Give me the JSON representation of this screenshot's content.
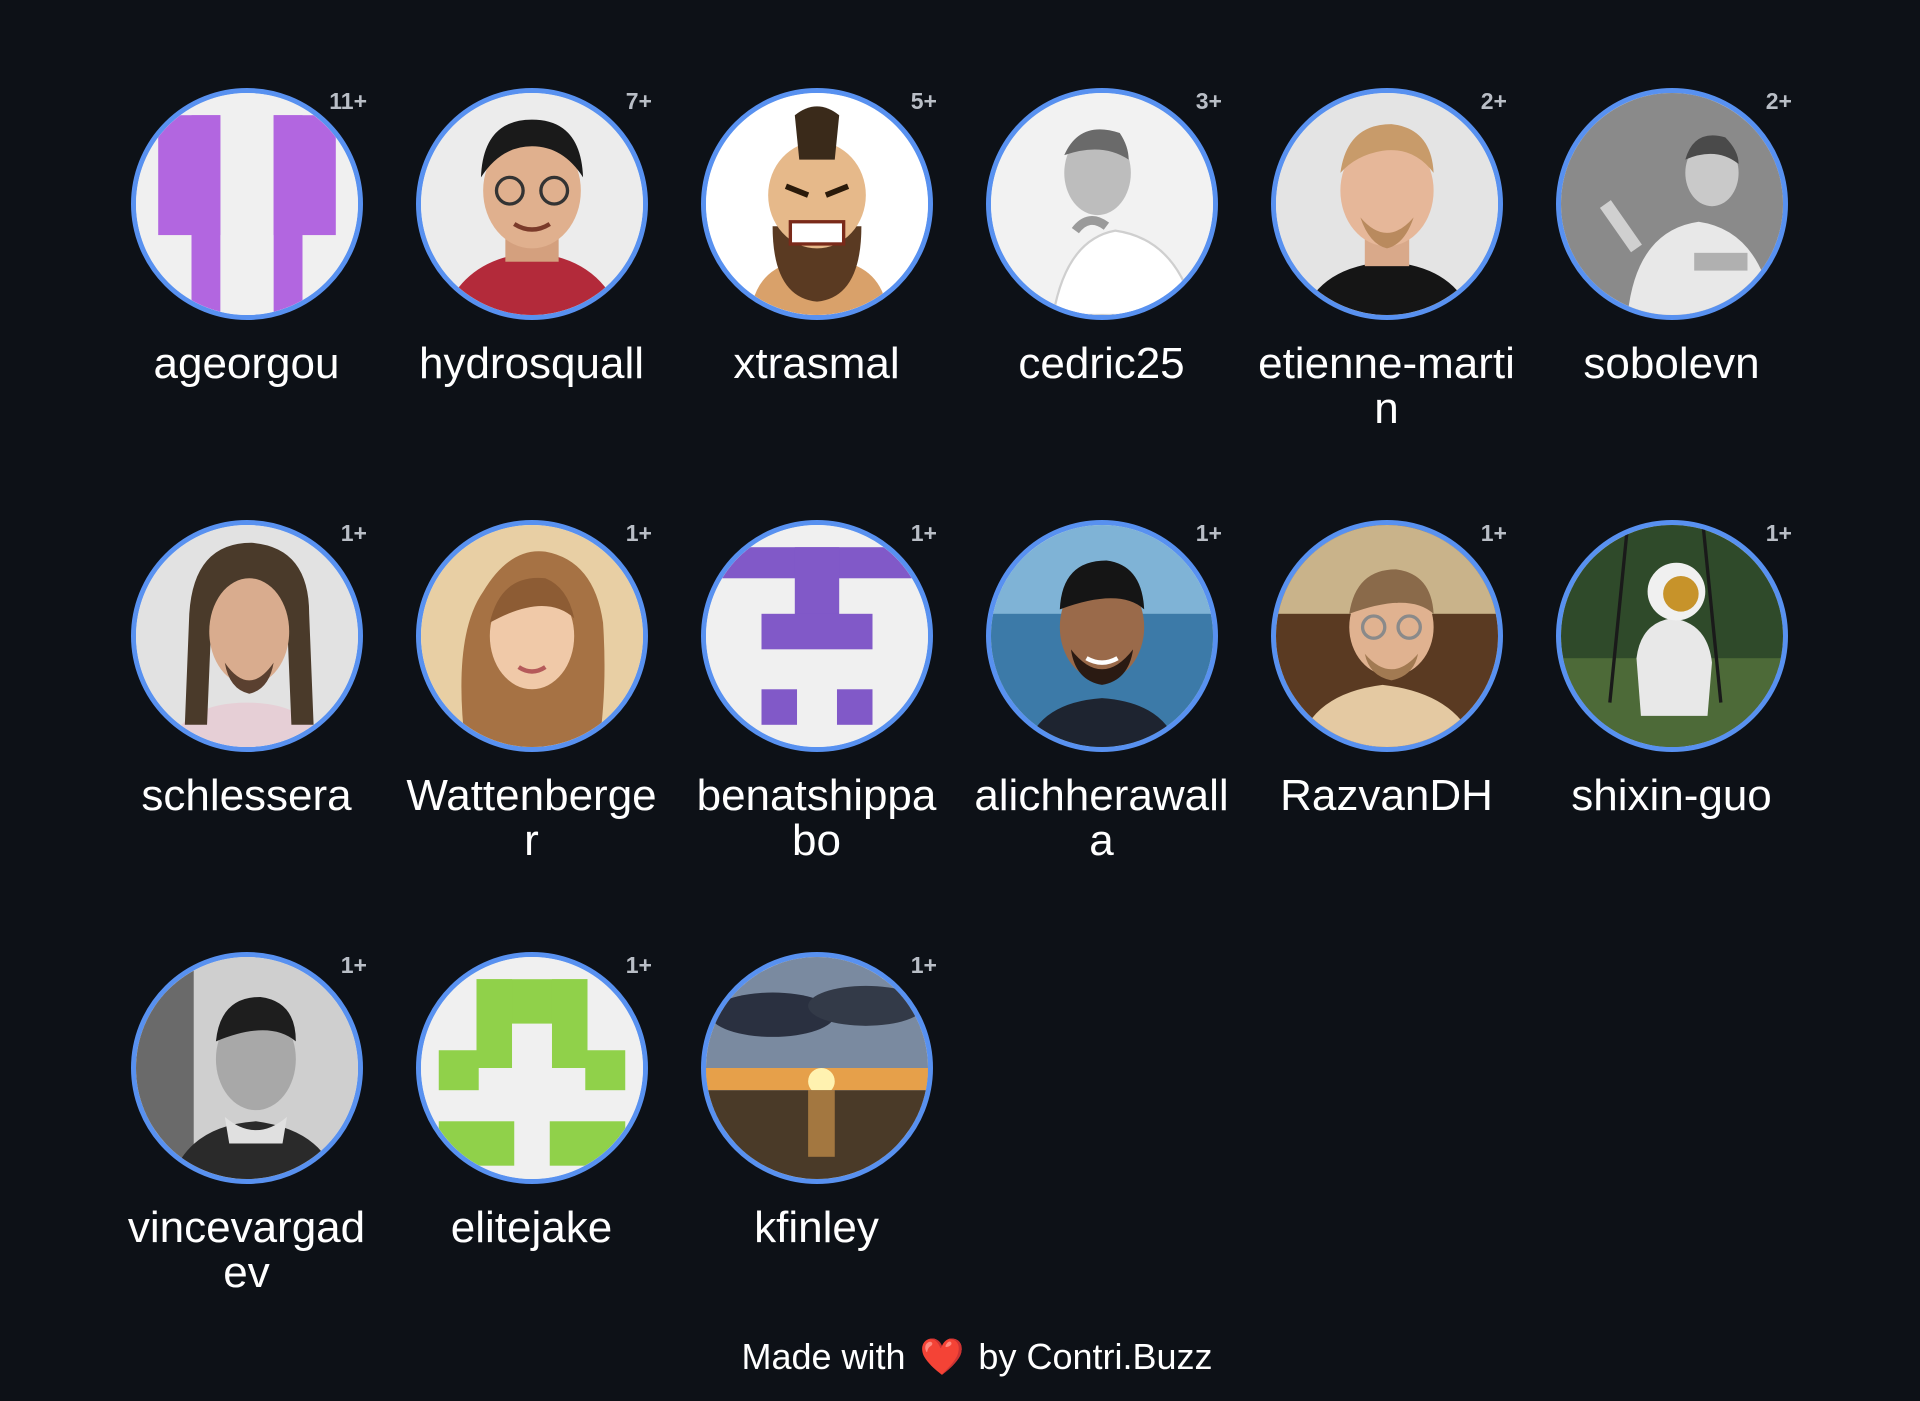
{
  "contributors": [
    {
      "name": "ageorgou",
      "count": "11+",
      "icon": "identicon-avatar-icon"
    },
    {
      "name": "hydrosquall",
      "count": "7+",
      "icon": "person-avatar-icon"
    },
    {
      "name": "xtrasmal",
      "count": "5+",
      "icon": "cartoon-character-avatar-icon"
    },
    {
      "name": "cedric25",
      "count": "3+",
      "icon": "person-avatar-icon"
    },
    {
      "name": "etienne-martin",
      "count": "2+",
      "icon": "person-avatar-icon"
    },
    {
      "name": "sobolevn",
      "count": "2+",
      "icon": "person-avatar-icon"
    },
    {
      "name": "schlessera",
      "count": "1+",
      "icon": "person-avatar-icon"
    },
    {
      "name": "Wattenberger",
      "count": "1+",
      "icon": "person-avatar-icon"
    },
    {
      "name": "benatshippabo",
      "count": "1+",
      "icon": "identicon-avatar-icon"
    },
    {
      "name": "alichherawalla",
      "count": "1+",
      "icon": "person-avatar-icon"
    },
    {
      "name": "RazvanDH",
      "count": "1+",
      "icon": "person-avatar-icon"
    },
    {
      "name": "shixin-guo",
      "count": "1+",
      "icon": "astronaut-avatar-icon"
    },
    {
      "name": "vincevargadev",
      "count": "1+",
      "icon": "person-avatar-icon"
    },
    {
      "name": "elitejake",
      "count": "1+",
      "icon": "identicon-avatar-icon"
    },
    {
      "name": "kfinley",
      "count": "1+",
      "icon": "sunset-avatar-icon"
    }
  ],
  "footer": {
    "prefix": "Made with",
    "heart": "❤️",
    "suffix": "by Contri.Buzz"
  },
  "colors": {
    "background": "#0d1117",
    "avatar_ring": "#5891f0",
    "count_text": "#b9bec6",
    "heart": "#e0312b"
  }
}
